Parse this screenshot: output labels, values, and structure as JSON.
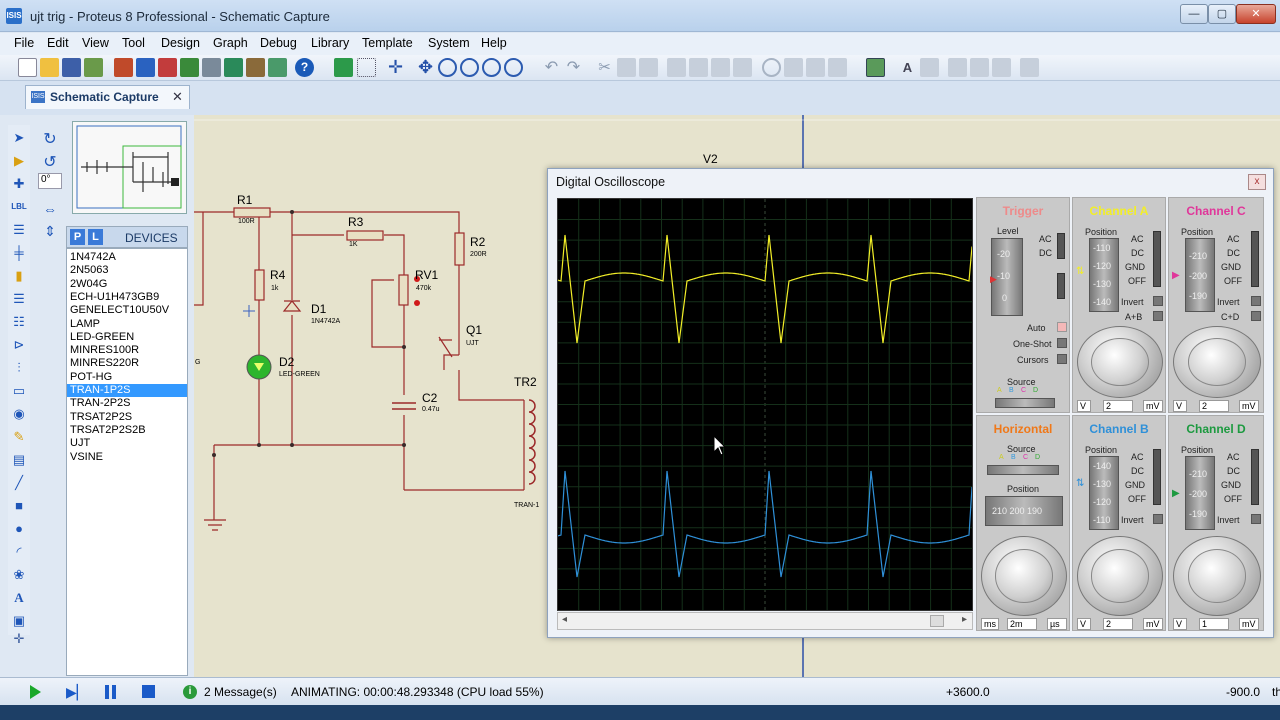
{
  "window": {
    "title": "ujt trig - Proteus 8 Professional - Schematic Capture",
    "app_icon": "proteus-icon"
  },
  "menu": [
    "File",
    "Edit",
    "View",
    "Tool",
    "Design",
    "Graph",
    "Debug",
    "Library",
    "Template",
    "System",
    "Help"
  ],
  "tab": {
    "label": "Schematic Capture",
    "close": "✕"
  },
  "rotation": {
    "value": "0°"
  },
  "devices": {
    "header": "DEVICES",
    "p_label": "P",
    "l_label": "L",
    "items": [
      "1N4742A",
      "2N5063",
      "2W04G",
      "ECH-U1H473GB9",
      "GENELECT10U50V",
      "LAMP",
      "LED-GREEN",
      "MINRES100R",
      "MINRES220R",
      "POT-HG",
      "TRAN-1P2S",
      "TRAN-2P2S",
      "TRSAT2P2S",
      "TRSAT2P2S2B",
      "UJT",
      "VSINE"
    ],
    "selected_index": 10
  },
  "schematic": {
    "v2": "V2",
    "r1": {
      "name": "R1",
      "value": "100R"
    },
    "r3": {
      "name": "R3",
      "value": "1K"
    },
    "r2": {
      "name": "R2",
      "value": "200R"
    },
    "r4": {
      "name": "R4",
      "value": "1k"
    },
    "d1": {
      "name": "D1",
      "value": "1N4742A"
    },
    "d2": {
      "name": "D2",
      "value": "LED-GREEN"
    },
    "rv1": {
      "name": "RV1",
      "value": "470k"
    },
    "q1": {
      "name": "Q1",
      "value": "UJT"
    },
    "c2": {
      "name": "C2",
      "value": "0.47u"
    },
    "tr2": {
      "name": "TR2",
      "value": "TRAN-1"
    },
    "g": "G"
  },
  "oscilloscope": {
    "title": "Digital Oscilloscope",
    "close": "x",
    "trigger": {
      "title": "Trigger",
      "level": "Level",
      "scale": [
        "-20",
        "-10",
        "0"
      ],
      "ac": "AC",
      "dc": "DC",
      "auto": "Auto",
      "oneshot": "One-Shot",
      "cursors": "Cursors",
      "source": "Source",
      "src_letters": [
        "A",
        "B",
        "C",
        "D"
      ]
    },
    "channel_a": {
      "title": "Channel A",
      "position": "Position",
      "scale": [
        "-110",
        "-120",
        "-130",
        "-140"
      ],
      "modes": [
        "AC",
        "DC",
        "GND",
        "OFF",
        "Invert",
        "A+B"
      ],
      "units": [
        "V",
        "2",
        "mV"
      ]
    },
    "channel_c": {
      "title": "Channel C",
      "position": "Position",
      "scale": [
        "-210",
        "-200",
        "-190"
      ],
      "modes": [
        "AC",
        "DC",
        "GND",
        "OFF",
        "Invert",
        "C+D"
      ],
      "units": [
        "V",
        "2",
        "mV"
      ]
    },
    "horizontal": {
      "title": "Horizontal",
      "source": "Source",
      "src_letters": [
        "A",
        "B",
        "C",
        "D"
      ],
      "position": "Position",
      "pos_scale": "210  200  190",
      "units": [
        "ms",
        "2m",
        "µs"
      ]
    },
    "channel_b": {
      "title": "Channel B",
      "position": "Position",
      "scale": [
        "-140",
        "-130",
        "-120",
        "-110"
      ],
      "modes": [
        "AC",
        "DC",
        "GND",
        "OFF",
        "Invert"
      ],
      "units": [
        "V",
        "2",
        "mV"
      ]
    },
    "channel_d": {
      "title": "Channel D",
      "position": "Position",
      "scale": [
        "-210",
        "-200",
        "-190"
      ],
      "modes": [
        "AC",
        "DC",
        "GND",
        "OFF",
        "Invert"
      ],
      "units": [
        "V",
        "1",
        "mV"
      ]
    },
    "colors": {
      "channel_a": "#f2ee28",
      "channel_b": "#2f90d8",
      "channel_c": "#e0379a",
      "channel_d": "#1d9a40",
      "trigger": "#e88",
      "horizontal": "#f07818"
    }
  },
  "status": {
    "messages": "2 Message(s)",
    "animating": "ANIMATING: 00:00:48.293348 (CPU load 55%)",
    "coord_x": "+3600.0",
    "coord_y": "-900.0",
    "th": "th"
  }
}
